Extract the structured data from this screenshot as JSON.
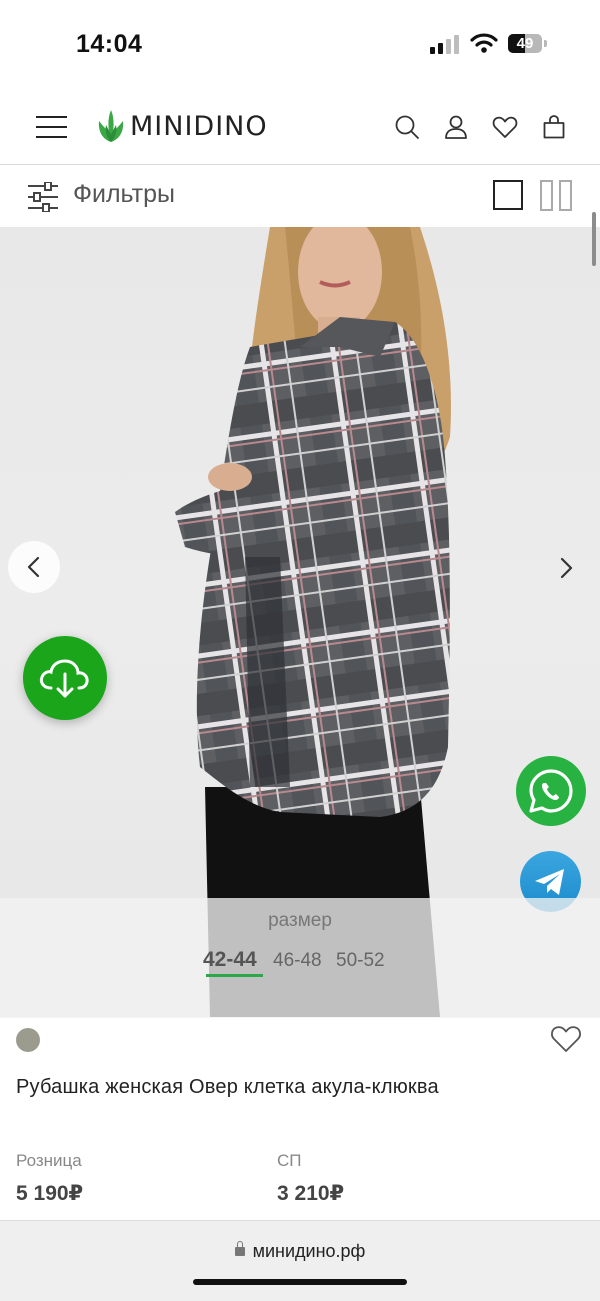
{
  "status_bar": {
    "time": "14:04",
    "battery": "49"
  },
  "header": {
    "logo_text": "MINIDINO",
    "icons": [
      "menu-icon",
      "search-icon",
      "user-icon",
      "heart-icon",
      "bag-icon"
    ]
  },
  "filter_bar": {
    "label": "Фильтры",
    "views": [
      "single-column-view",
      "two-column-view"
    ]
  },
  "product": {
    "size_title": "размер",
    "sizes": [
      {
        "label": "42-44",
        "selected": true
      },
      {
        "label": "46-48",
        "selected": false
      },
      {
        "label": "50-52",
        "selected": false
      }
    ],
    "color": "#9b9b8e",
    "title": "Рубашка женская Овер клетка акула-клюква",
    "retail_label": "Розница",
    "retail_price": "5 190₽",
    "sp_label": "СП",
    "sp_price": "3 210₽"
  },
  "floating_buttons": [
    "download-icon",
    "whatsapp-icon",
    "telegram-icon"
  ],
  "colors": {
    "accent_green": "#1aa51b",
    "whatsapp": "#28b242",
    "telegram": "#2a9bd8"
  },
  "browser": {
    "url": "минидино.рф"
  }
}
